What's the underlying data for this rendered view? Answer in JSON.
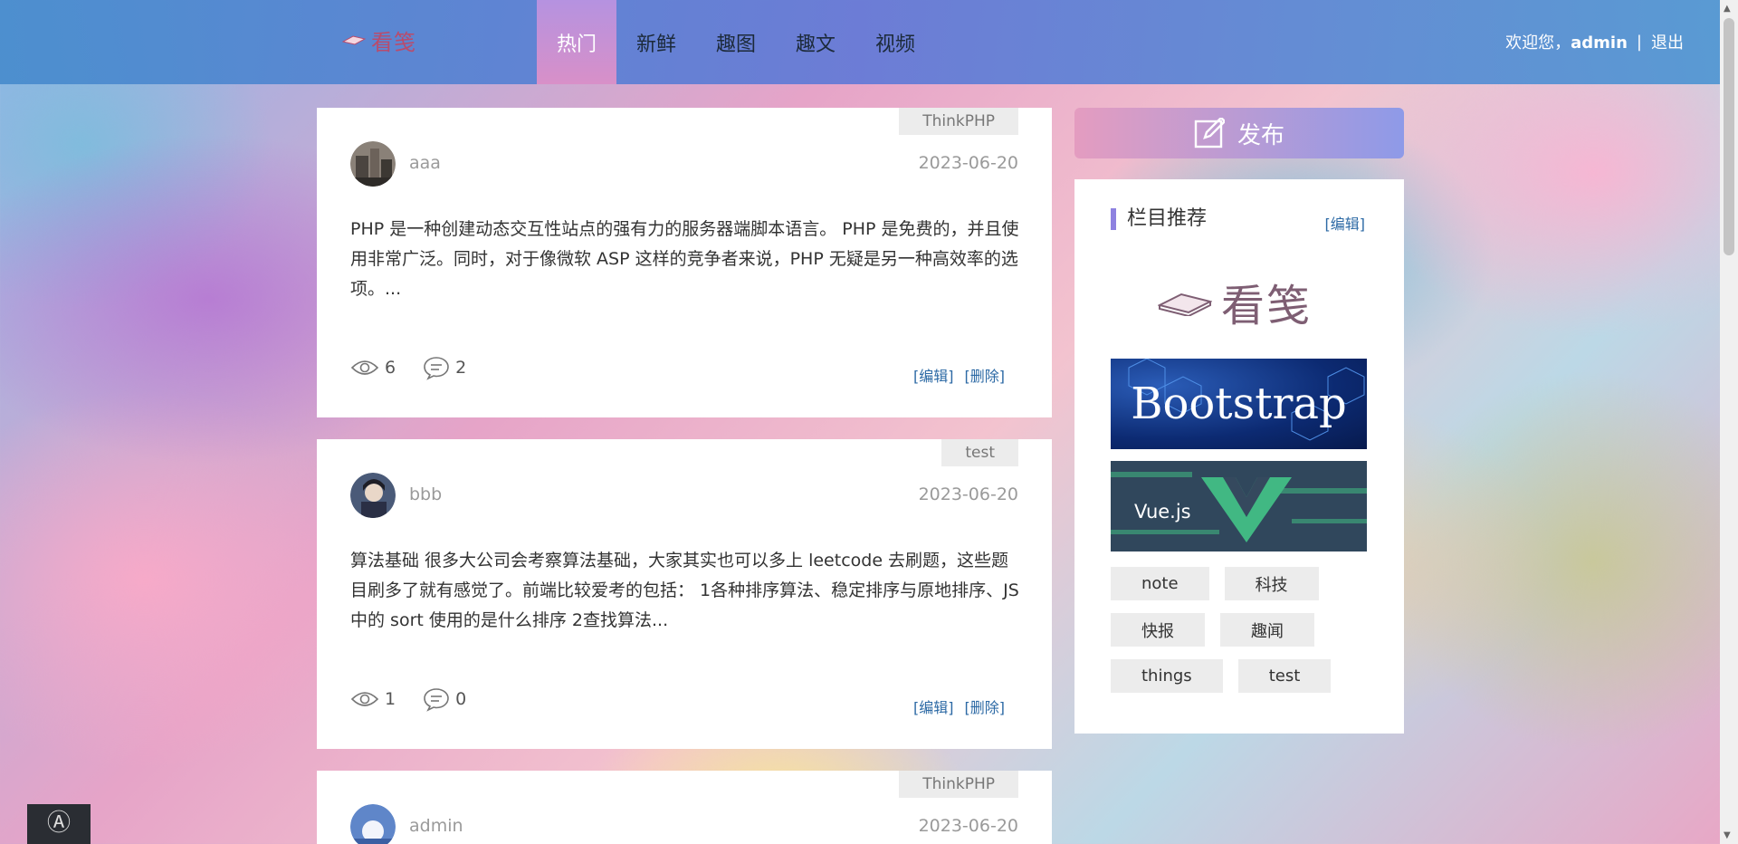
{
  "brand": {
    "logo_text": "看笺"
  },
  "nav": {
    "items": [
      {
        "label": "热门",
        "active": true
      },
      {
        "label": "新鲜",
        "active": false
      },
      {
        "label": "趣图",
        "active": false
      },
      {
        "label": "趣文",
        "active": false
      },
      {
        "label": "视频",
        "active": false
      }
    ]
  },
  "user": {
    "welcome": "欢迎您，",
    "name": "admin",
    "separator": "|",
    "logout": "退出"
  },
  "posts": [
    {
      "tag": "ThinkPHP",
      "author": "aaa",
      "date": "2023-06-20",
      "excerpt": "PHP 是一种创建动态交互性站点的强有力的服务器端脚本语言。 PHP 是免费的，并且使用非常广泛。同时，对于像微软 ASP 这样的竞争者来说，PHP 无疑是另一种高效率的选项。...",
      "views": "6",
      "comments": "2",
      "edit": "[编辑]",
      "delete": "[删除]"
    },
    {
      "tag": "test",
      "author": "bbb",
      "date": "2023-06-20",
      "excerpt": "算法基础 很多大公司会考察算法基础，大家其实也可以多上 leetcode 去刷题，这些题目刷多了就有感觉了。前端比较爱考的包括： 1各种排序算法、稳定排序与原地排序、JS 中的 sort 使用的是什么排序 2查找算法...",
      "views": "1",
      "comments": "0",
      "edit": "[编辑]",
      "delete": "[删除]"
    },
    {
      "tag": "ThinkPHP",
      "author": "admin",
      "date": "2023-06-20"
    }
  ],
  "sidebar": {
    "publish_label": "发布",
    "panel_title": "栏目推荐",
    "panel_edit": "[编辑]",
    "logo_text": "看笺",
    "banner_bootstrap": "Bootstrap",
    "banner_vue": "Vue.js",
    "tags": [
      "note",
      "科技",
      "快报",
      "趣闻",
      "things",
      "test"
    ]
  }
}
